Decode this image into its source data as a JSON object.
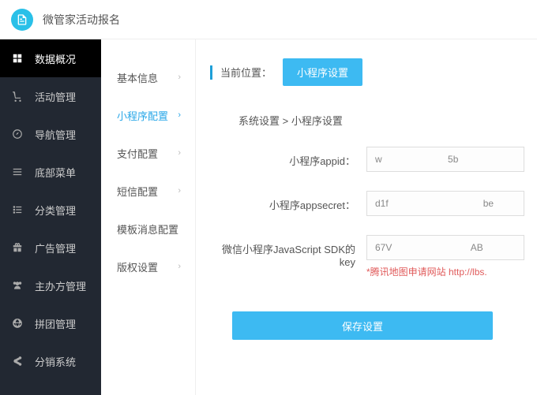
{
  "header": {
    "title": "微管家活动报名"
  },
  "sidebar": {
    "items": [
      {
        "label": "数据概况",
        "name": "sidebar-item-dashboard"
      },
      {
        "label": "活动管理",
        "name": "sidebar-item-activity"
      },
      {
        "label": "导航管理",
        "name": "sidebar-item-nav"
      },
      {
        "label": "底部菜单",
        "name": "sidebar-item-bottom-menu"
      },
      {
        "label": "分类管理",
        "name": "sidebar-item-category"
      },
      {
        "label": "广告管理",
        "name": "sidebar-item-ads"
      },
      {
        "label": "主办方管理",
        "name": "sidebar-item-organizer"
      },
      {
        "label": "拼团管理",
        "name": "sidebar-item-group-buy"
      },
      {
        "label": "分销系统",
        "name": "sidebar-item-distribution"
      }
    ]
  },
  "subnav": {
    "items": [
      {
        "label": "基本信息",
        "name": "subnav-basic"
      },
      {
        "label": "小程序配置",
        "name": "subnav-miniprogram",
        "active": true
      },
      {
        "label": "支付配置",
        "name": "subnav-payment"
      },
      {
        "label": "短信配置",
        "name": "subnav-sms"
      },
      {
        "label": "模板消息配置",
        "name": "subnav-template",
        "nochev": true
      },
      {
        "label": "版权设置",
        "name": "subnav-copyright"
      }
    ]
  },
  "main": {
    "loc_label": "当前位置：",
    "loc_button": "小程序设置",
    "breadcrumb": "系统设置 > 小程序设置",
    "fields": {
      "appid": {
        "label": "小程序appid：",
        "value": "w                         5b"
      },
      "secret": {
        "label": "小程序appsecret：",
        "value": "d1f                                    be"
      },
      "sdkkey": {
        "label": "微信小程序JavaScript SDK的key",
        "value": "67V                              AB",
        "hint": "*腾讯地图申请网站 http://lbs."
      }
    },
    "save_label": "保存设置"
  }
}
